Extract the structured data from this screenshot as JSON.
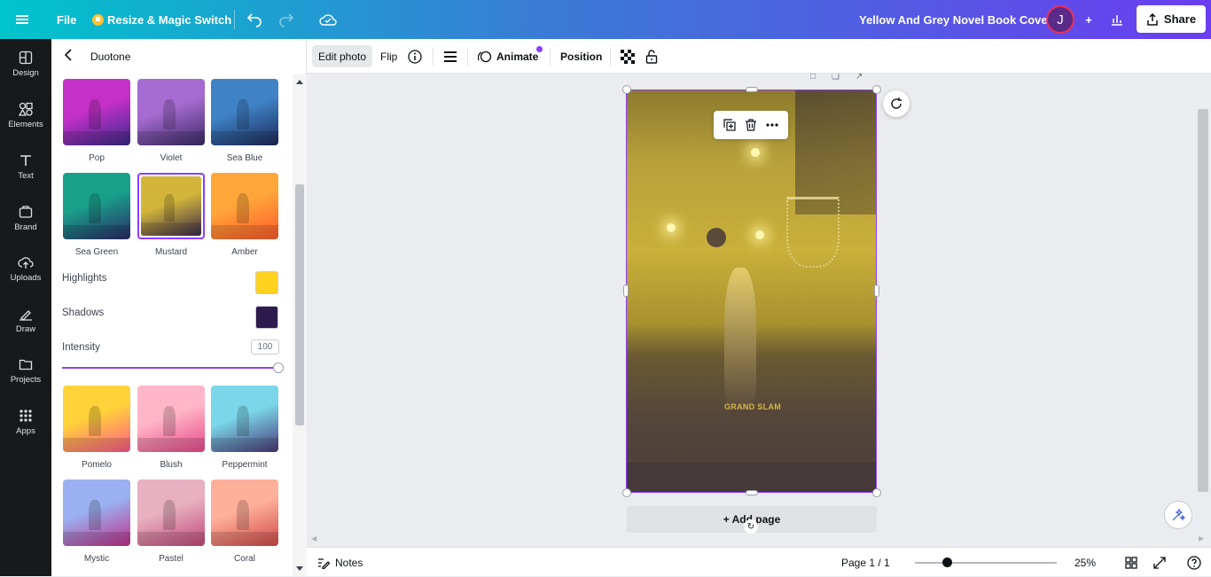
{
  "topbar": {
    "file_label": "File",
    "resize_label": "Resize & Magic Switch",
    "doc_title": "Yellow And Grey Novel Book Cover",
    "avatar_initial": "J",
    "share_label": "Share"
  },
  "rail": {
    "items": [
      {
        "label": "Design",
        "icon": "design-icon"
      },
      {
        "label": "Elements",
        "icon": "elements-icon"
      },
      {
        "label": "Text",
        "icon": "text-icon"
      },
      {
        "label": "Brand",
        "icon": "brand-icon"
      },
      {
        "label": "Uploads",
        "icon": "uploads-icon"
      },
      {
        "label": "Draw",
        "icon": "draw-icon"
      },
      {
        "label": "Projects",
        "icon": "folder-icon"
      },
      {
        "label": "Apps",
        "icon": "apps-icon"
      }
    ]
  },
  "panel": {
    "title": "Duotone",
    "presets_top": [
      {
        "label": "Pop",
        "c1": "#c430c8",
        "c2": "#3a2a8a"
      },
      {
        "label": "Violet",
        "c1": "#a56bd0",
        "c2": "#3b2a66"
      },
      {
        "label": "Sea Blue",
        "c1": "#3f83c6",
        "c2": "#1c2a5a"
      },
      {
        "label": "Sea Green",
        "c1": "#19a08a",
        "c2": "#2a2a66"
      },
      {
        "label": "Mustard",
        "c1": "#d2b53a",
        "c2": "#3b2a4a"
      },
      {
        "label": "Amber",
        "c1": "#ffa63a",
        "c2": "#ff5a2a"
      }
    ],
    "selected_preset": "Mustard",
    "highlights_label": "Highlights",
    "highlights_color": "#ffd21f",
    "shadows_label": "Shadows",
    "shadows_color": "#2d1b4e",
    "intensity_label": "Intensity",
    "intensity_value": "100",
    "presets_bottom": [
      {
        "label": "Pomelo",
        "c1": "#ffd23a",
        "c2": "#ff5a8a"
      },
      {
        "label": "Blush",
        "c1": "#ffb6c8",
        "c2": "#e84a8a"
      },
      {
        "label": "Peppermint",
        "c1": "#7ad6e8",
        "c2": "#4a3a7a"
      },
      {
        "label": "Mystic",
        "c1": "#9ab0f0",
        "c2": "#c0308a"
      },
      {
        "label": "Pastel",
        "c1": "#e8b0c0",
        "c2": "#c04a7a"
      },
      {
        "label": "Coral",
        "c1": "#ffb09a",
        "c2": "#d04a4a"
      }
    ]
  },
  "context_toolbar": {
    "edit_photo": "Edit photo",
    "flip": "Flip",
    "animate": "Animate",
    "position": "Position"
  },
  "canvas": {
    "image_text": "GRAND SLAM",
    "add_page": "+ Add page"
  },
  "bottombar": {
    "notes": "Notes",
    "page_indicator": "Page 1 / 1",
    "zoom": "25%",
    "zoom_level": 0.25
  },
  "colors": {
    "accent": "#8b3dff",
    "topbar_start": "#00c4cc",
    "topbar_end": "#6a3df0"
  }
}
